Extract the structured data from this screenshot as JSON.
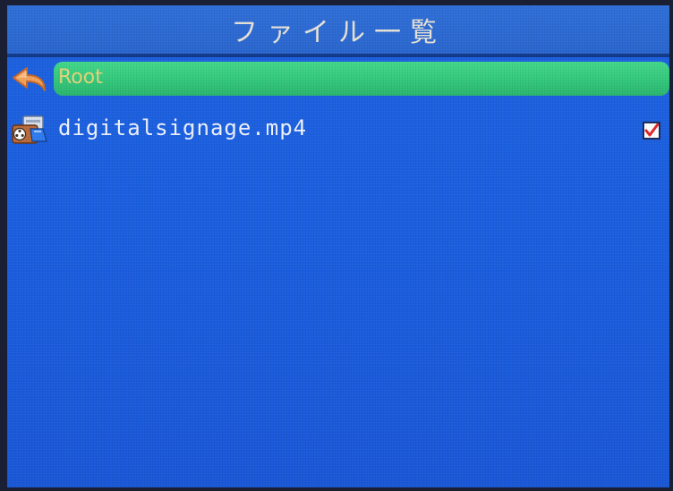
{
  "header": {
    "title": "ファイル一覧"
  },
  "list": {
    "items": [
      {
        "label": "Root",
        "icon": "back-arrow-icon",
        "selected": true
      },
      {
        "label": "digitalsignage.mp4",
        "icon": "video-file-icon",
        "checked": true,
        "check_icon": "checkmark-icon"
      }
    ]
  },
  "colors": {
    "background": "#1b5fe0",
    "header": "#2a66cf",
    "highlight": "#33c87c",
    "root_text": "#e6d47a",
    "file_text": "#eef2ff",
    "check": "#e0262a"
  }
}
